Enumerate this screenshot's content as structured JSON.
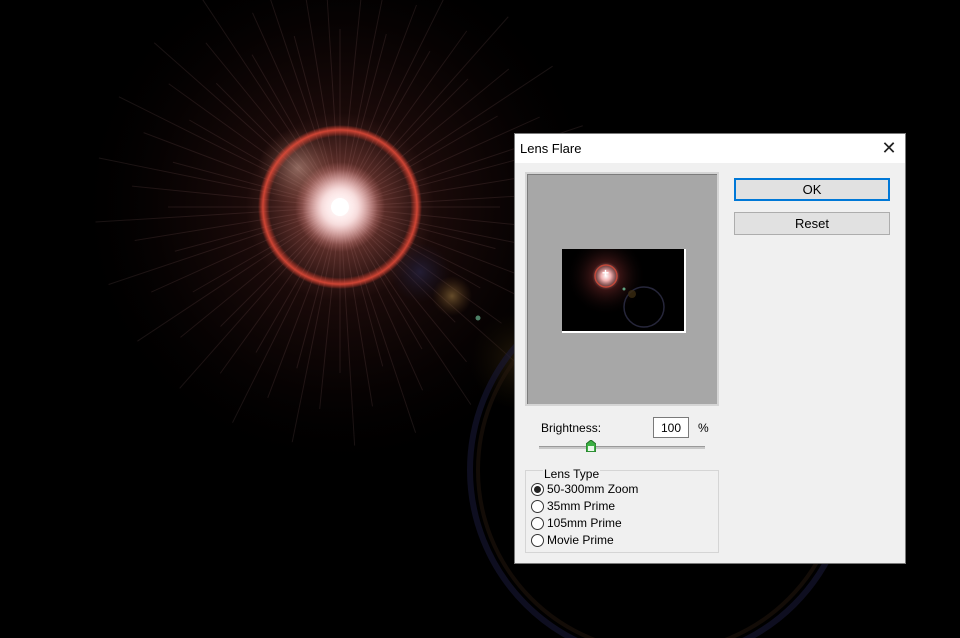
{
  "dialog": {
    "title": "Lens Flare",
    "close_glyph": "✕",
    "ok_label": "OK",
    "reset_label": "Reset"
  },
  "brightness": {
    "label": "Brightness:",
    "value": "100",
    "unit": "%"
  },
  "lens_type": {
    "legend": "Lens Type",
    "options": [
      {
        "label": "50-300mm Zoom",
        "selected": true
      },
      {
        "label": "35mm Prime",
        "selected": false
      },
      {
        "label": "105mm Prime",
        "selected": false
      },
      {
        "label": "Movie Prime",
        "selected": false
      }
    ]
  },
  "preview": {
    "crosshair_glyph": "+"
  },
  "colors": {
    "flare_core": "#ffffff",
    "flare_ring": "#c0392b",
    "dialog_bg": "#f0f0f0",
    "focus_border": "#0078d7"
  }
}
